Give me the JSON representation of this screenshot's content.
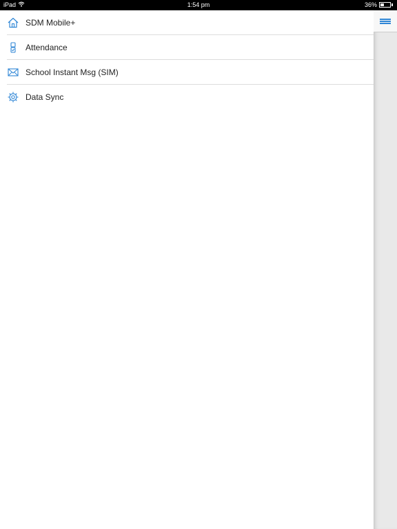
{
  "status_bar": {
    "device": "iPad",
    "time": "1:54 pm",
    "battery_percent": "36%",
    "battery_level": 0.36
  },
  "menu": {
    "items": [
      {
        "label": "SDM Mobile+",
        "icon": "home-icon"
      },
      {
        "label": "Attendance",
        "icon": "attendance-icon"
      },
      {
        "label": "School Instant Msg (SIM)",
        "icon": "envelope-icon"
      },
      {
        "label": "Data Sync",
        "icon": "gear-icon"
      }
    ]
  },
  "colors": {
    "accent": "#2f86d6",
    "status_bar_bg": "#000000",
    "side_panel_bg": "#e9e9e9"
  }
}
